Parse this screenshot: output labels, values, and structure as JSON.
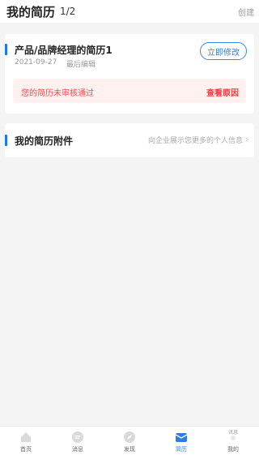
{
  "header": {
    "title": "我的简历",
    "count": "1/2",
    "create_label": "创建"
  },
  "resume": {
    "name": "产品/品牌经理的简历1",
    "date": "2021-09-27",
    "edit_note": "最后编辑",
    "edit_button": "立即修改",
    "alert_message": "您的简历未审核通过",
    "alert_action": "查看原因"
  },
  "attachment": {
    "title": "我的简历附件",
    "hint": "向企业展示您更多的个人信息"
  },
  "tabs": [
    {
      "label": "首页",
      "icon": "home-icon"
    },
    {
      "label": "消息",
      "icon": "message-icon"
    },
    {
      "label": "发现",
      "icon": "discover-icon"
    },
    {
      "label": "简历",
      "icon": "resume-icon",
      "active": true
    },
    {
      "label": "我的",
      "icon": "profile-icon",
      "badge_text": "讯息"
    }
  ],
  "colors": {
    "accent": "#1c7ae8",
    "alert_text": "#f24d4d",
    "alert_bg": "#fff1f0"
  }
}
